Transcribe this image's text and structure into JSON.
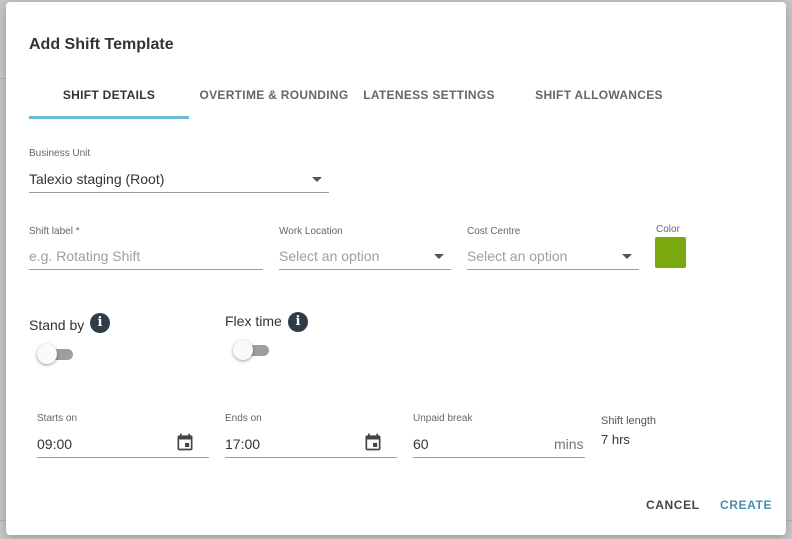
{
  "dialog": {
    "title": "Add Shift Template"
  },
  "tabs": [
    {
      "label": "SHIFT DETAILS",
      "active": true
    },
    {
      "label": "OVERTIME & ROUNDING",
      "active": false
    },
    {
      "label": "LATENESS SETTINGS",
      "active": false
    },
    {
      "label": "SHIFT ALLOWANCES",
      "active": false
    }
  ],
  "business_unit": {
    "label": "Business Unit",
    "value": "Talexio staging (Root)"
  },
  "shift_label": {
    "label": "Shift label *",
    "placeholder": "e.g. Rotating Shift"
  },
  "work_location": {
    "label": "Work Location",
    "placeholder": "Select an option"
  },
  "cost_centre": {
    "label": "Cost Centre",
    "placeholder": "Select an option"
  },
  "color": {
    "label": "Color",
    "value": "#7aa90f"
  },
  "stand_by": {
    "label": "Stand by",
    "enabled": false
  },
  "flex_time": {
    "label": "Flex time",
    "enabled": false
  },
  "starts_on": {
    "label": "Starts on",
    "value": "09:00"
  },
  "ends_on": {
    "label": "Ends on",
    "value": "17:00"
  },
  "unpaid_break": {
    "label": "Unpaid break",
    "value": "60",
    "unit": "mins"
  },
  "shift_length": {
    "label": "Shift length",
    "value": "7 hrs"
  },
  "actions": {
    "cancel": "CANCEL",
    "create": "CREATE",
    "cancel_color": "#444444",
    "create_color": "#4a8fb0"
  }
}
